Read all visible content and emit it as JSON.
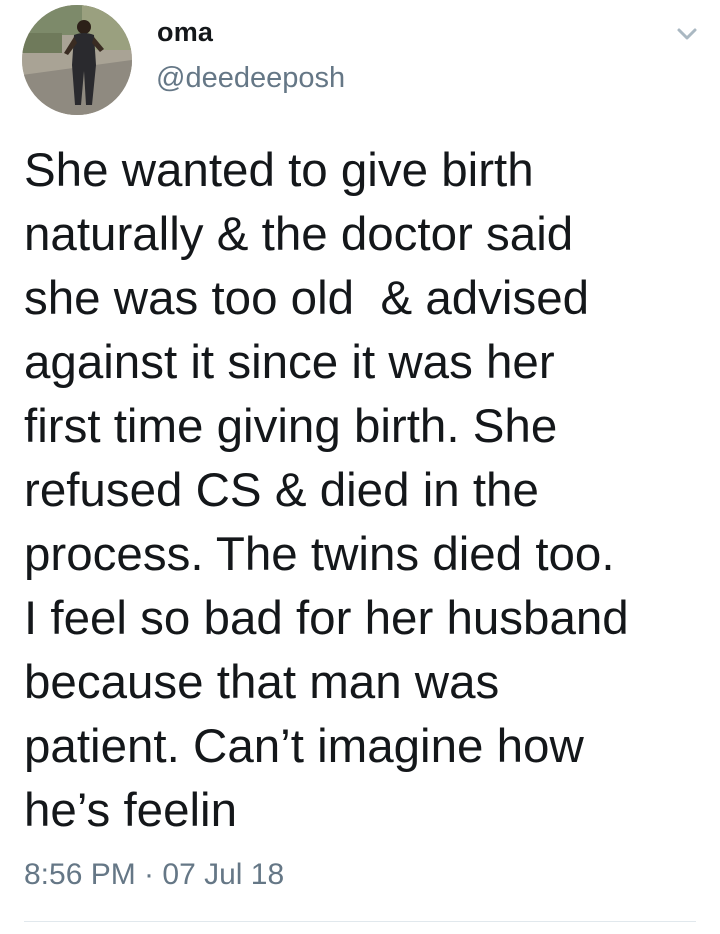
{
  "author": {
    "display_name": "oma",
    "handle": "@deedeeposh",
    "avatar_icon": "profile-photo"
  },
  "menu": {
    "icon": "chevron-down-icon"
  },
  "tweet": {
    "text": "She wanted to give birth\nnaturally & the doctor said\nshe was too old  & advised\nagainst it since it was her\nfirst time giving birth. She\nrefused CS & died in the\nprocess. The twins died too.\nI feel so bad for her husband\nbecause that man was\npatient. Can’t imagine how\nhe’s feelin",
    "timestamp": "8:56 PM · 07 Jul 18"
  },
  "colors": {
    "text": "#14171a",
    "secondary": "#657786",
    "divider": "#e1e8ed"
  }
}
